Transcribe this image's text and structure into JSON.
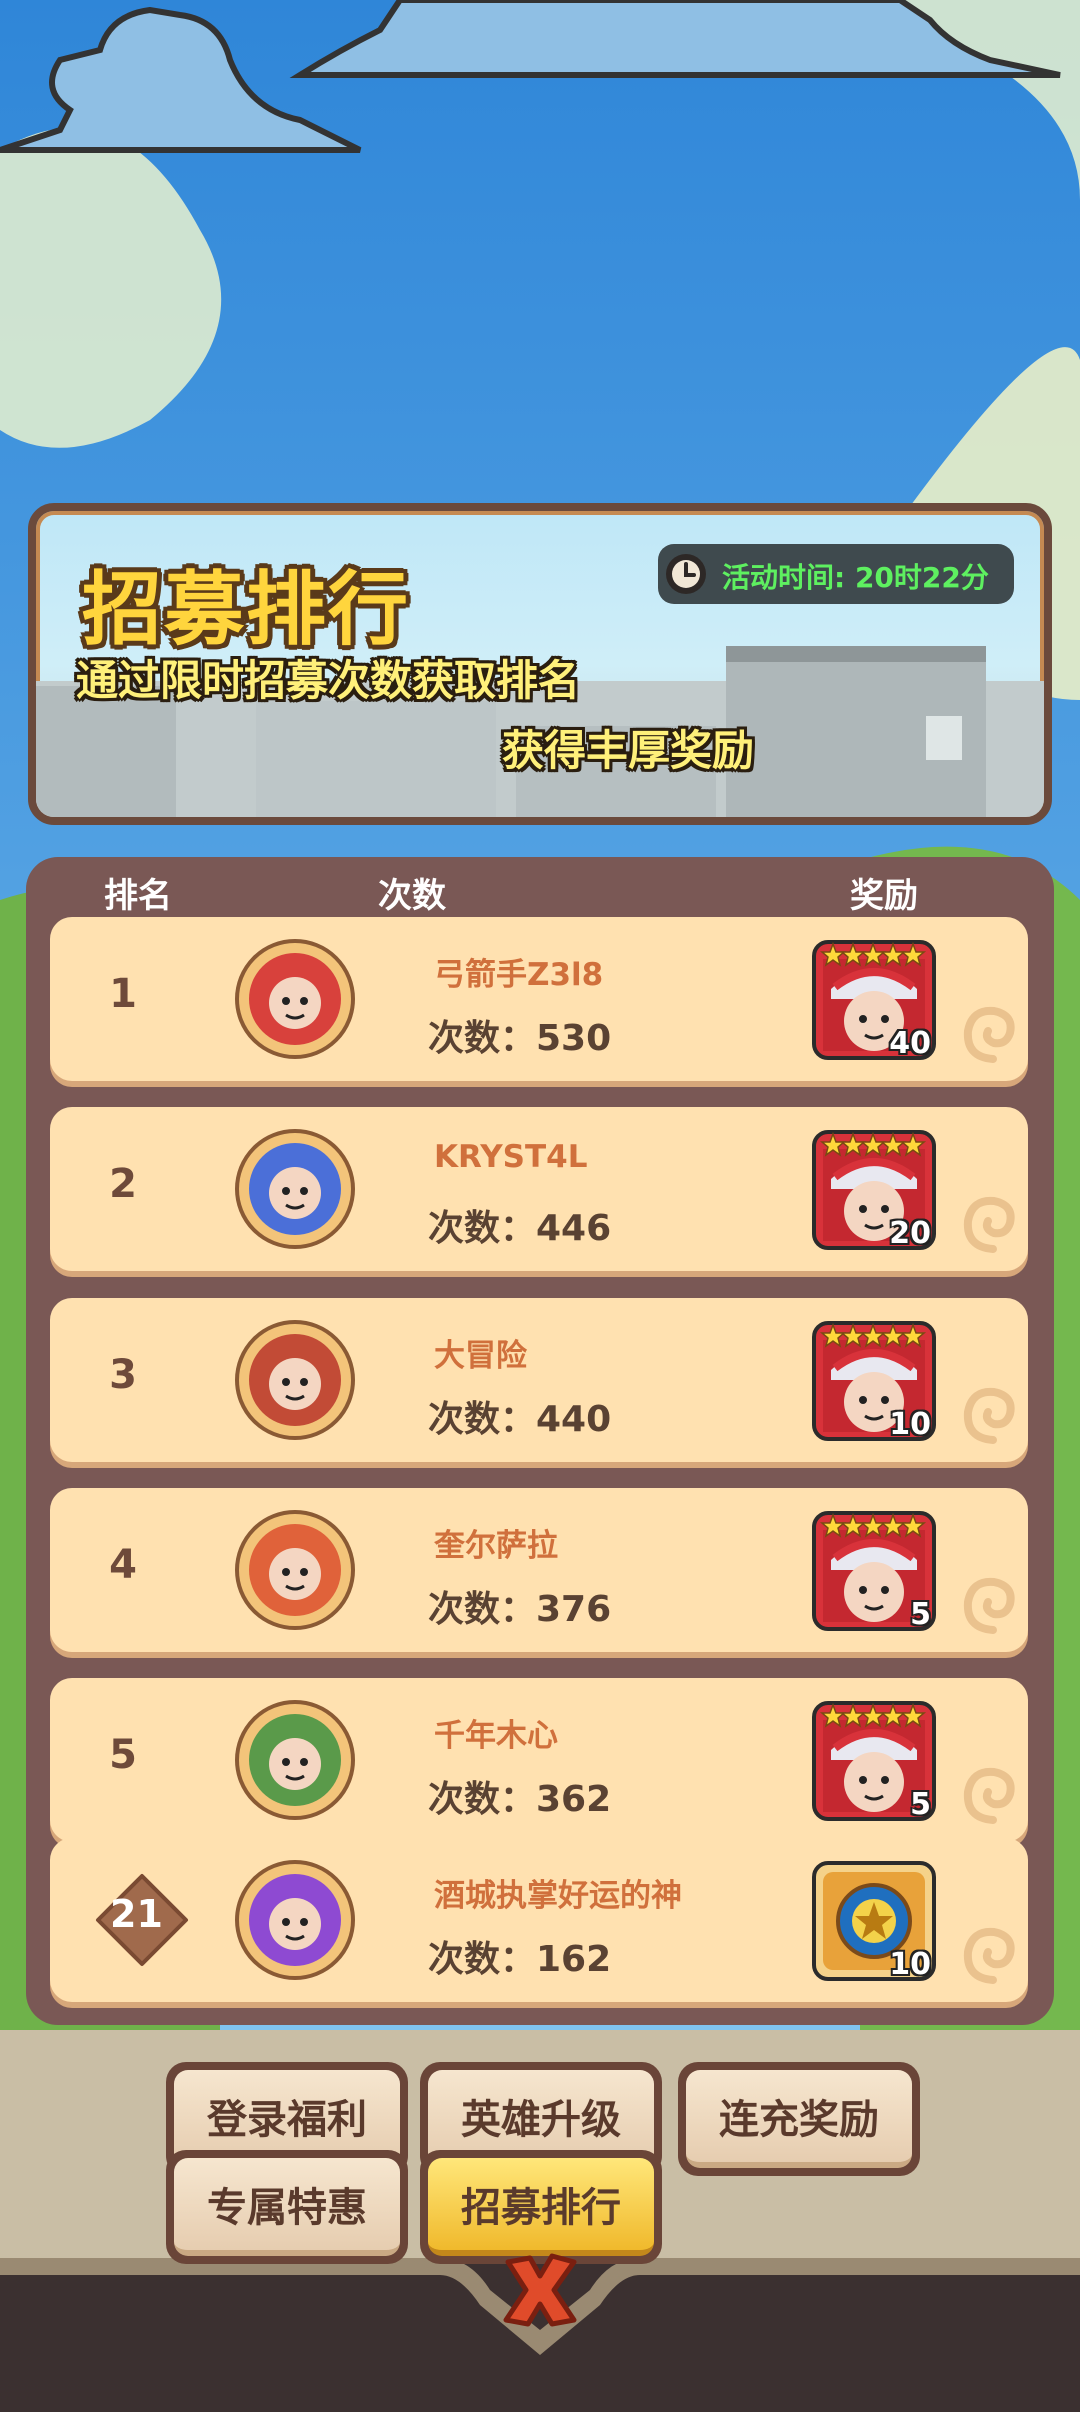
{
  "banner": {
    "title": "招募排行",
    "subtitle_line1": "通过限时招募次数获取排名",
    "subtitle_line2": "获得丰厚奖励",
    "timer_icon": "clock-icon",
    "timer_text": "活动时间: 20时22分"
  },
  "table_headers": {
    "rank": "排名",
    "count": "次数",
    "reward": "奖励"
  },
  "rows": [
    {
      "rank": "1",
      "name": "弓箭手Z3l8",
      "count": "次数：530",
      "reward_qty": "40",
      "avatar": "archer-badge-icon",
      "reward_icon": "five-star-hero-icon"
    },
    {
      "rank": "2",
      "name": "KRYST4L",
      "count": "次数：446",
      "reward_qty": "20",
      "avatar": "winged-sloth-badge-icon",
      "reward_icon": "five-star-hero-icon"
    },
    {
      "rank": "3",
      "name": "大冒险",
      "count": "次数：440",
      "reward_qty": "10",
      "avatar": "fox-sloth-badge-icon",
      "reward_icon": "five-star-hero-icon"
    },
    {
      "rank": "4",
      "name": "奎尔萨拉",
      "count": "次数：376",
      "reward_qty": "5",
      "avatar": "star-dragon-badge-icon",
      "reward_icon": "five-star-hero-icon"
    },
    {
      "rank": "5",
      "name": "千年木心",
      "count": "次数：362",
      "reward_qty": "5",
      "avatar": "green-creature-badge-icon",
      "reward_icon": "five-star-hero-icon"
    }
  ],
  "my_row": {
    "rank": "21",
    "name": "酒城执掌好运的神",
    "count": "次数：162",
    "reward_qty": "10",
    "avatar": "purple-bird-badge-icon",
    "reward_icon": "golden-scroll-icon"
  },
  "tabs": [
    "登录福利",
    "英雄升级",
    "连充奖励",
    "专属特惠",
    "招募排行"
  ],
  "active_tab": "招募排行",
  "close_icon": "close-x-icon",
  "colors": {
    "panel": "#7a5855",
    "row_bg": "#ffe1b0",
    "name": "#d0703c",
    "timer_text": "#5ef060",
    "title": "#ffd53d",
    "active_tab": "#f0b92c"
  }
}
